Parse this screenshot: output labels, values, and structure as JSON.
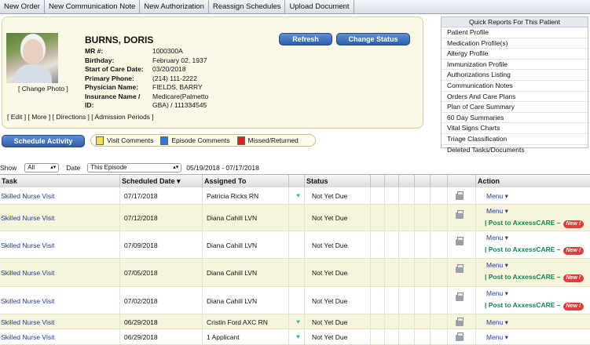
{
  "toolbar": {
    "new_order": "New Order",
    "new_communication_note": "New Communication Note",
    "new_authorization": "New Authorization",
    "reassign_schedules": "Reassign Schedules",
    "upload_document": "Upload Document"
  },
  "patient": {
    "name": "BURNS, DORIS",
    "change_photo": "[ Change Photo ]",
    "fields": [
      {
        "label": "MR #:",
        "value": "1000300A"
      },
      {
        "label": "Birthday:",
        "value": "February 02, 1937"
      },
      {
        "label": "Start of Care Date:",
        "value": "03/20/2018"
      },
      {
        "label": "Primary Phone:",
        "value": "(214) 111-2222"
      },
      {
        "label": "Physician Name:",
        "value": "FIELDS, BARRY"
      },
      {
        "label": "Insurance Name /",
        "value": "Medicare(Palmetto"
      },
      {
        "label": "ID:",
        "value": "GBA) / 111334545"
      }
    ],
    "links": {
      "edit": "[ Edit ]",
      "more": "[ More ]",
      "directions": "[ Directions ]",
      "admission_periods": "[ Admission Periods ]"
    },
    "refresh_label": "Refresh",
    "change_status_label": "Change Status"
  },
  "quick_reports": {
    "title": "Quick Reports For This Patient",
    "items": [
      "Patient Profile",
      "Medication Profile(s)",
      "Allergy Profile",
      "Immunization Profile",
      "Authorizations Listing",
      "Communication Notes",
      "Orders And Care Plans",
      "Plan of Care Summary",
      "60 Day Summaries",
      "Vital Signs Charts",
      "Triage Classification",
      "Deleted Tasks/Documents"
    ]
  },
  "schedule_activity_label": "Schedule Activity",
  "legend": {
    "visit_comments": "Visit Comments",
    "episode_comments": "Episode Comments",
    "missed_returned": "Missed/Returned",
    "colors": {
      "visit": "#f2e23a",
      "episode": "#2f78d8",
      "missed": "#e02020"
    }
  },
  "filter": {
    "show_label": "Show",
    "show_value": "All",
    "date_label": "Date",
    "date_value": "This Episode",
    "date_range": "05/19/2018 - 07/17/2018"
  },
  "table": {
    "headers": {
      "task": "Task",
      "scheduled_date": "Scheduled Date",
      "sort_icon": "▾",
      "assigned_to": "Assigned To",
      "status": "Status",
      "action": "Action"
    },
    "menu_label": "Menu",
    "post_label": "Post to AxxessCARE –",
    "new_badge": "New !",
    "rows": [
      {
        "task": "Skilled Nurse Visit",
        "date": "07/17/2018",
        "assigned": "Patricia Ricks RN",
        "heart": true,
        "status": "Not Yet Due",
        "post": false
      },
      {
        "task": "Skilled Nurse Visit",
        "date": "07/12/2018",
        "assigned": "Diana Cahill LVN",
        "heart": false,
        "status": "Not Yet Due",
        "post": true
      },
      {
        "task": "Skilled Nurse Visit",
        "date": "07/09/2018",
        "assigned": "Diana Cahill LVN",
        "heart": false,
        "status": "Not Yet Due",
        "post": true
      },
      {
        "task": "Skilled Nurse Visit",
        "date": "07/05/2018",
        "assigned": "Diana Cahill LVN",
        "heart": false,
        "status": "Not Yet Due",
        "post": true
      },
      {
        "task": "Skilled Nurse Visit",
        "date": "07/02/2018",
        "assigned": "Diana Cahill LVN",
        "heart": false,
        "status": "Not Yet Due",
        "post": true
      },
      {
        "task": "Skilled Nurse Visit",
        "date": "06/29/2018",
        "assigned": "Cristin Ford AXC RN",
        "heart": true,
        "status": "Not Yet Due",
        "post": false
      },
      {
        "task": "Skilled Nurse Visit",
        "date": "06/29/2018",
        "assigned": "1 Applicant",
        "heart": true,
        "status": "Not Yet Due",
        "post": false
      }
    ]
  }
}
